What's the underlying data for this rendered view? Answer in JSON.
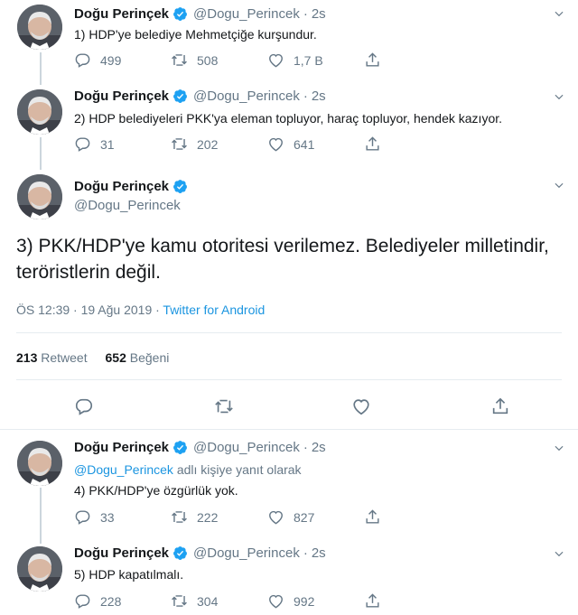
{
  "author": {
    "name": "Doğu Perinçek",
    "handle": "@Dogu_Perincek"
  },
  "tweets": [
    {
      "time": "2s",
      "text": "1) HDP'ye belediye Mehmetçiğe kurşundur.",
      "replies": "499",
      "retweets": "508",
      "likes": "1,7 B"
    },
    {
      "time": "2s",
      "text": "2) HDP belediyeleri PKK'ya eleman topluyor, haraç topluyor, hendek kazıyor.",
      "replies": "31",
      "retweets": "202",
      "likes": "641"
    },
    {
      "time": "2s",
      "reply_to": "@Dogu_Perincek",
      "reply_suffix": "adlı kişiye yanıt olarak",
      "text": "4) PKK/HDP'ye özgürlük yok.",
      "replies": "33",
      "retweets": "222",
      "likes": "827"
    },
    {
      "time": "2s",
      "text": "5) HDP kapatılmalı.",
      "replies": "228",
      "retweets": "304",
      "likes": "992"
    }
  ],
  "main": {
    "text": "3) PKK/HDP'ye kamu otoritesi verilemez. Belediyeler milletindir, teröristlerin değil.",
    "timestamp": "ÖS 12:39 · 19 Ağu 2019 · ",
    "source": "Twitter for Android",
    "retweet_count": "213",
    "retweet_label": "Retweet",
    "like_count": "652",
    "like_label": "Beğeni"
  },
  "sep": "·",
  "colors": {
    "link": "#1b95e0",
    "verified": "#1da1f2",
    "muted": "#657786"
  },
  "icons": [
    "verified-badge-icon",
    "chevron-down-icon",
    "reply-icon",
    "retweet-icon",
    "like-icon",
    "share-icon"
  ]
}
